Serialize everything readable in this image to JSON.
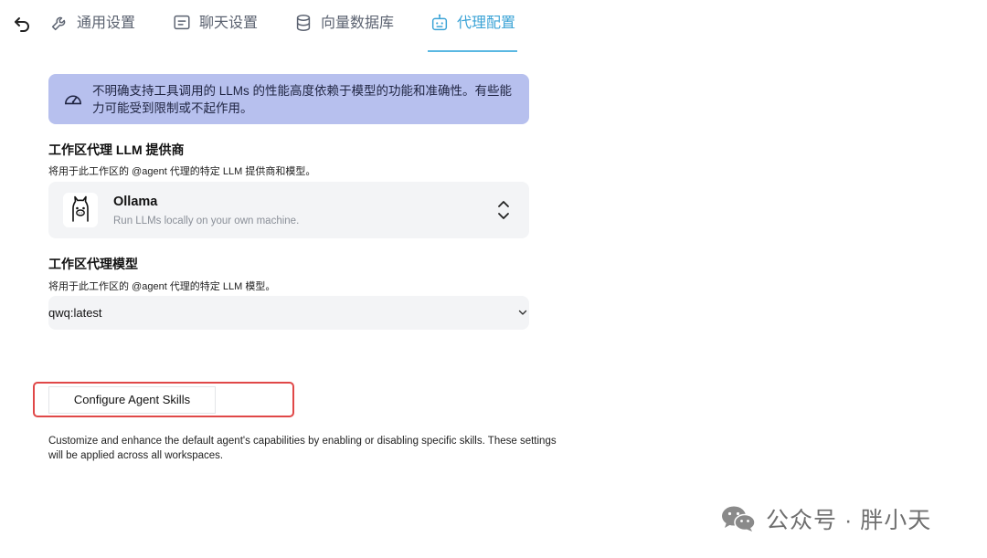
{
  "tabs": [
    {
      "label": "通用设置",
      "icon": "wrench-icon",
      "active": false
    },
    {
      "label": "聊天设置",
      "icon": "chat-text-icon",
      "active": false
    },
    {
      "label": "向量数据库",
      "icon": "database-icon",
      "active": false
    },
    {
      "label": "代理配置",
      "icon": "robot-icon",
      "active": true
    }
  ],
  "notice": {
    "icon": "gauge-icon",
    "text": "不明确支持工具调用的 LLMs 的性能高度依赖于模型的功能和准确性。有些能力可能受到限制或不起作用。"
  },
  "provider_section": {
    "title": "工作区代理 LLM 提供商",
    "description": "将用于此工作区的 @agent 代理的特定 LLM 提供商和模型。",
    "selected": {
      "name": "Ollama",
      "description": "Run LLMs locally on your own machine.",
      "logo": "llama-icon"
    }
  },
  "model_section": {
    "title": "工作区代理模型",
    "description": "将用于此工作区的 @agent 代理的特定 LLM 模型。",
    "selected_value": "qwq:latest"
  },
  "skills": {
    "button_label": "Configure Agent Skills",
    "description": "Customize and enhance the default agent's capabilities by enabling or disabling specific skills. These settings will be applied across all workspaces."
  },
  "watermark": {
    "text": "公众号 · 胖小天"
  },
  "colors": {
    "accent": "#3ba3d6",
    "notice_bg": "#b7c0ee",
    "card_bg": "#f3f4f6",
    "highlight": "#e04848"
  }
}
